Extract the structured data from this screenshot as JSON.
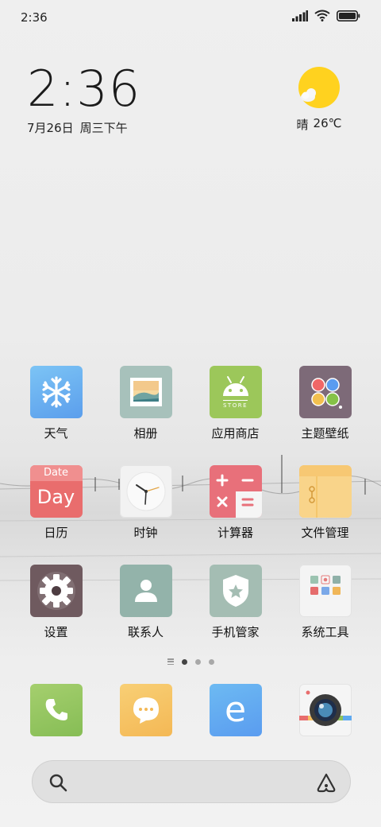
{
  "status_bar": {
    "time": "2:36",
    "icons": [
      "signal-icon",
      "wifi-icon",
      "battery-icon"
    ]
  },
  "clock_widget": {
    "time": "2:36",
    "date": "7月26日",
    "weekday": "周三下午"
  },
  "weather_widget": {
    "icon": "sun-cloud-icon",
    "condition": "晴",
    "temperature": "26℃"
  },
  "apps": [
    {
      "label": "天气",
      "icon": "weather-snowflake-icon"
    },
    {
      "label": "相册",
      "icon": "gallery-icon"
    },
    {
      "label": "应用商店",
      "icon": "store-icon",
      "store_text": "STORE"
    },
    {
      "label": "主题壁纸",
      "icon": "themes-icon"
    },
    {
      "label": "日历",
      "icon": "calendar-icon",
      "date_text": "Date",
      "day_text": "Day"
    },
    {
      "label": "时钟",
      "icon": "clock-icon"
    },
    {
      "label": "计算器",
      "icon": "calculator-icon"
    },
    {
      "label": "文件管理",
      "icon": "folder-icon"
    },
    {
      "label": "设置",
      "icon": "settings-gear-icon"
    },
    {
      "label": "联系人",
      "icon": "contacts-icon"
    },
    {
      "label": "手机管家",
      "icon": "security-shield-icon"
    },
    {
      "label": "系统工具",
      "icon": "tools-folder-icon"
    }
  ],
  "page_indicator": {
    "pages": 3,
    "current": 1
  },
  "dock": [
    {
      "icon": "phone-icon"
    },
    {
      "icon": "messages-icon"
    },
    {
      "icon": "browser-icon",
      "text": "e"
    },
    {
      "icon": "camera-icon"
    }
  ],
  "search": {
    "icon": "search-icon",
    "assistant_icon": "assistant-icon"
  },
  "colors": {
    "weather_tile": "#6aaef0",
    "gallery_tile": "#a7c1bb",
    "store_tile": "#9cc75a",
    "themes_tile": "#7d6a78",
    "calendar_tile": "#e96d6d",
    "clock_tile": "#f2f2f2",
    "calculator_tile": "#e8707a",
    "folder_tile": "#f7c873",
    "settings_tile": "#6f5a5f",
    "contacts_tile": "#93b3aa",
    "security_tile": "#a4bdb3",
    "tools_tile": "#f4f4f4",
    "phone_tile": "#8fc35a",
    "messages_tile": "#f6c063",
    "browser_tile": "#5fa9f0",
    "sun": "#ffd21f"
  }
}
